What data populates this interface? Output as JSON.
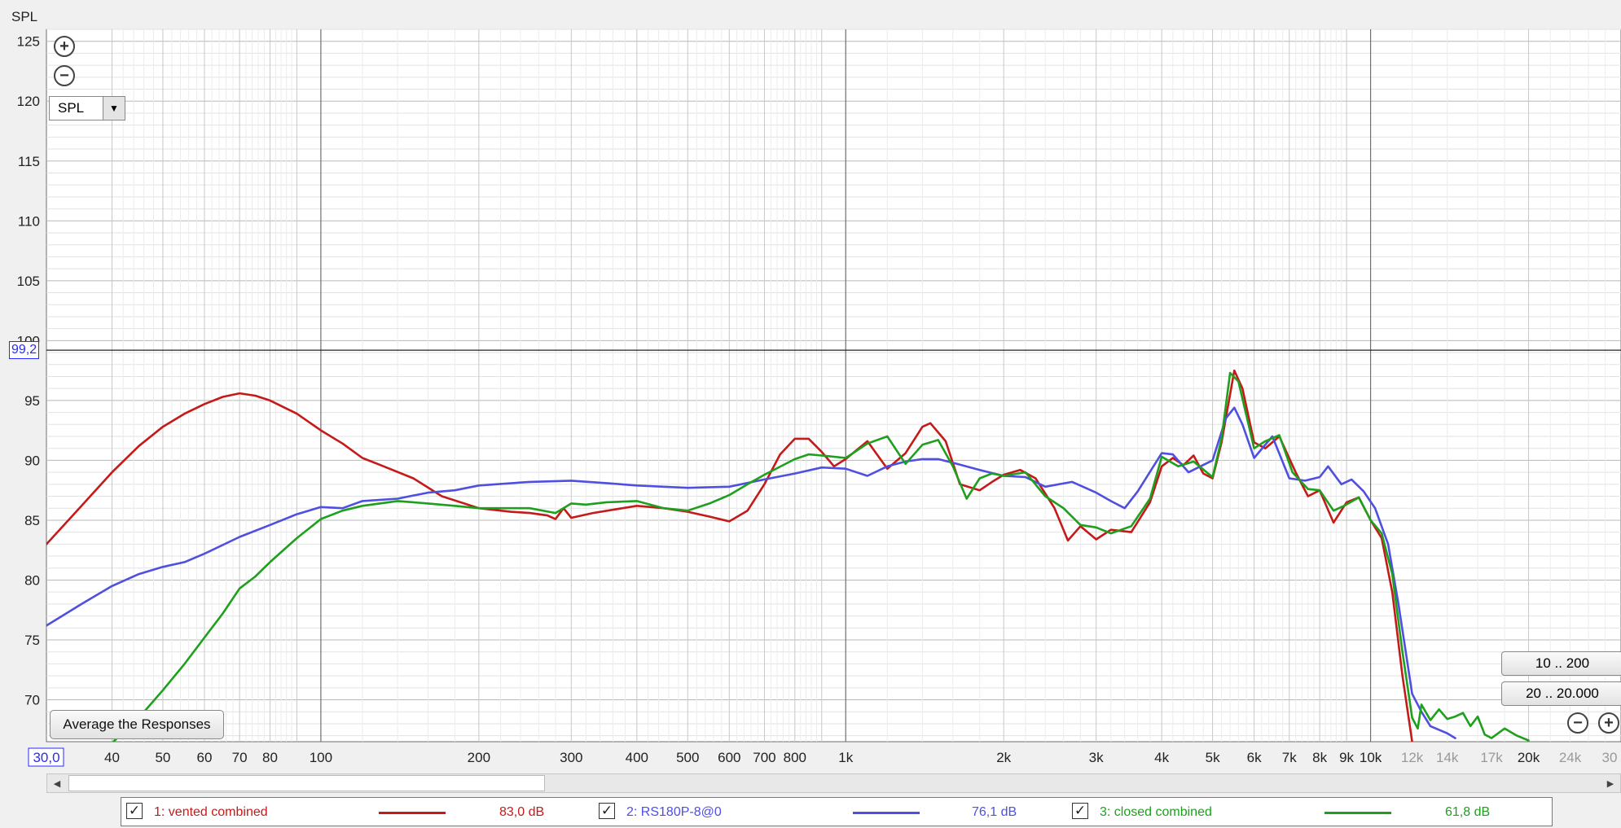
{
  "chart_data": {
    "type": "line",
    "title": "",
    "ylabel": "SPL",
    "xlabel": "",
    "x_scale": "log",
    "xlim": [
      30,
      30000
    ],
    "ylim": [
      66.5,
      126
    ],
    "y_ticks": [
      70,
      75,
      80,
      85,
      90,
      95,
      100,
      105,
      110,
      115,
      120,
      125
    ],
    "x_ticks": [
      {
        "v": 30,
        "label": "30,0",
        "highlight": true
      },
      {
        "v": 40,
        "label": "40"
      },
      {
        "v": 50,
        "label": "50"
      },
      {
        "v": 60,
        "label": "60"
      },
      {
        "v": 70,
        "label": "70"
      },
      {
        "v": 80,
        "label": "80"
      },
      {
        "v": 100,
        "label": "100"
      },
      {
        "v": 200,
        "label": "200"
      },
      {
        "v": 300,
        "label": "300"
      },
      {
        "v": 400,
        "label": "400"
      },
      {
        "v": 500,
        "label": "500"
      },
      {
        "v": 600,
        "label": "600"
      },
      {
        "v": 700,
        "label": "700"
      },
      {
        "v": 800,
        "label": "800"
      },
      {
        "v": 1000,
        "label": "1k"
      },
      {
        "v": 2000,
        "label": "2k"
      },
      {
        "v": 3000,
        "label": "3k"
      },
      {
        "v": 4000,
        "label": "4k"
      },
      {
        "v": 5000,
        "label": "5k"
      },
      {
        "v": 6000,
        "label": "6k"
      },
      {
        "v": 7000,
        "label": "7k"
      },
      {
        "v": 8000,
        "label": "8k"
      },
      {
        "v": 9000,
        "label": "9k"
      },
      {
        "v": 10000,
        "label": "10k"
      },
      {
        "v": 12000,
        "label": "12k",
        "faint": true
      },
      {
        "v": 14000,
        "label": "14k",
        "faint": true
      },
      {
        "v": 17000,
        "label": "17k",
        "faint": true
      },
      {
        "v": 20000,
        "label": "20k"
      },
      {
        "v": 24000,
        "label": "24k",
        "faint": true
      },
      {
        "v": 30000,
        "label": "30",
        "faint": true
      }
    ],
    "cursor": {
      "y": 99.2,
      "label": "99,2"
    },
    "grid": true,
    "series": [
      {
        "name": "1: vented combined",
        "color": "#c41a1a",
        "legend_value": "83,0 dB",
        "points": [
          [
            30,
            83.0
          ],
          [
            35,
            86.2
          ],
          [
            40,
            89.0
          ],
          [
            45,
            91.2
          ],
          [
            50,
            92.8
          ],
          [
            55,
            93.9
          ],
          [
            60,
            94.7
          ],
          [
            65,
            95.3
          ],
          [
            70,
            95.6
          ],
          [
            75,
            95.4
          ],
          [
            80,
            95.0
          ],
          [
            90,
            93.9
          ],
          [
            100,
            92.5
          ],
          [
            110,
            91.4
          ],
          [
            120,
            90.2
          ],
          [
            130,
            89.6
          ],
          [
            150,
            88.5
          ],
          [
            170,
            87.0
          ],
          [
            200,
            86.0
          ],
          [
            230,
            85.7
          ],
          [
            250,
            85.6
          ],
          [
            270,
            85.4
          ],
          [
            280,
            85.1
          ],
          [
            290,
            86.0
          ],
          [
            300,
            85.2
          ],
          [
            330,
            85.6
          ],
          [
            400,
            86.2
          ],
          [
            450,
            86.0
          ],
          [
            500,
            85.7
          ],
          [
            550,
            85.3
          ],
          [
            600,
            84.9
          ],
          [
            650,
            85.8
          ],
          [
            700,
            88.0
          ],
          [
            750,
            90.5
          ],
          [
            800,
            91.8
          ],
          [
            850,
            91.8
          ],
          [
            900,
            90.7
          ],
          [
            950,
            89.5
          ],
          [
            1000,
            90.1
          ],
          [
            1100,
            91.6
          ],
          [
            1200,
            89.3
          ],
          [
            1300,
            90.6
          ],
          [
            1400,
            92.8
          ],
          [
            1450,
            93.1
          ],
          [
            1550,
            91.6
          ],
          [
            1650,
            88.0
          ],
          [
            1800,
            87.5
          ],
          [
            1900,
            88.2
          ],
          [
            2000,
            88.8
          ],
          [
            2150,
            89.2
          ],
          [
            2300,
            88.5
          ],
          [
            2500,
            86.0
          ],
          [
            2650,
            83.3
          ],
          [
            2800,
            84.5
          ],
          [
            3000,
            83.4
          ],
          [
            3200,
            84.2
          ],
          [
            3500,
            84.0
          ],
          [
            3800,
            86.5
          ],
          [
            4000,
            89.5
          ],
          [
            4200,
            90.2
          ],
          [
            4400,
            89.6
          ],
          [
            4600,
            90.4
          ],
          [
            4800,
            88.9
          ],
          [
            5000,
            88.5
          ],
          [
            5200,
            91.5
          ],
          [
            5500,
            97.5
          ],
          [
            5700,
            96.0
          ],
          [
            6000,
            91.5
          ],
          [
            6300,
            91.0
          ],
          [
            6700,
            92.0
          ],
          [
            7200,
            89.0
          ],
          [
            7600,
            87.0
          ],
          [
            8000,
            87.5
          ],
          [
            8500,
            84.8
          ],
          [
            9000,
            86.5
          ],
          [
            9500,
            86.9
          ],
          [
            10000,
            85.0
          ],
          [
            10500,
            83.5
          ],
          [
            11000,
            79.0
          ],
          [
            11500,
            72.0
          ],
          [
            12000,
            66.5
          ]
        ]
      },
      {
        "name": "2: RS180P-8@0",
        "color": "#4f4fe0",
        "legend_value": "76,1 dB",
        "points": [
          [
            30,
            76.2
          ],
          [
            35,
            78.0
          ],
          [
            40,
            79.5
          ],
          [
            45,
            80.5
          ],
          [
            50,
            81.1
          ],
          [
            55,
            81.5
          ],
          [
            60,
            82.2
          ],
          [
            70,
            83.6
          ],
          [
            80,
            84.6
          ],
          [
            90,
            85.5
          ],
          [
            100,
            86.1
          ],
          [
            110,
            86.0
          ],
          [
            120,
            86.6
          ],
          [
            140,
            86.8
          ],
          [
            160,
            87.3
          ],
          [
            180,
            87.5
          ],
          [
            200,
            87.9
          ],
          [
            250,
            88.2
          ],
          [
            300,
            88.3
          ],
          [
            350,
            88.1
          ],
          [
            400,
            87.9
          ],
          [
            500,
            87.7
          ],
          [
            600,
            87.8
          ],
          [
            700,
            88.4
          ],
          [
            800,
            88.9
          ],
          [
            900,
            89.4
          ],
          [
            1000,
            89.3
          ],
          [
            1100,
            88.7
          ],
          [
            1200,
            89.5
          ],
          [
            1300,
            89.9
          ],
          [
            1400,
            90.1
          ],
          [
            1500,
            90.1
          ],
          [
            1600,
            89.8
          ],
          [
            1800,
            89.2
          ],
          [
            2000,
            88.7
          ],
          [
            2200,
            88.6
          ],
          [
            2400,
            87.8
          ],
          [
            2700,
            88.2
          ],
          [
            3000,
            87.3
          ],
          [
            3200,
            86.6
          ],
          [
            3400,
            86.0
          ],
          [
            3600,
            87.4
          ],
          [
            4000,
            90.6
          ],
          [
            4200,
            90.5
          ],
          [
            4500,
            89.0
          ],
          [
            5000,
            90.0
          ],
          [
            5300,
            93.5
          ],
          [
            5500,
            94.4
          ],
          [
            5700,
            93.0
          ],
          [
            6000,
            90.2
          ],
          [
            6500,
            92.0
          ],
          [
            7000,
            88.5
          ],
          [
            7500,
            88.3
          ],
          [
            8000,
            88.6
          ],
          [
            8300,
            89.5
          ],
          [
            8800,
            88.0
          ],
          [
            9200,
            88.4
          ],
          [
            9700,
            87.4
          ],
          [
            10200,
            86.0
          ],
          [
            10800,
            83.0
          ],
          [
            11300,
            78.0
          ],
          [
            12000,
            70.5
          ],
          [
            12500,
            69.0
          ],
          [
            13000,
            67.8
          ],
          [
            14000,
            67.2
          ],
          [
            14500,
            66.8
          ]
        ]
      },
      {
        "name": "3: closed combined",
        "color": "#1ea01e",
        "legend_value": "61,8 dB",
        "points": [
          [
            40,
            66.4
          ],
          [
            45,
            68.5
          ],
          [
            50,
            70.8
          ],
          [
            55,
            73.0
          ],
          [
            60,
            75.2
          ],
          [
            65,
            77.2
          ],
          [
            70,
            79.3
          ],
          [
            75,
            80.3
          ],
          [
            80,
            81.5
          ],
          [
            90,
            83.5
          ],
          [
            100,
            85.1
          ],
          [
            110,
            85.8
          ],
          [
            120,
            86.2
          ],
          [
            140,
            86.6
          ],
          [
            160,
            86.4
          ],
          [
            180,
            86.2
          ],
          [
            200,
            86.0
          ],
          [
            250,
            86.0
          ],
          [
            280,
            85.6
          ],
          [
            300,
            86.4
          ],
          [
            320,
            86.3
          ],
          [
            350,
            86.5
          ],
          [
            400,
            86.6
          ],
          [
            450,
            86.0
          ],
          [
            500,
            85.8
          ],
          [
            550,
            86.4
          ],
          [
            600,
            87.1
          ],
          [
            650,
            88.0
          ],
          [
            700,
            88.8
          ],
          [
            800,
            90.1
          ],
          [
            850,
            90.5
          ],
          [
            900,
            90.4
          ],
          [
            1000,
            90.2
          ],
          [
            1100,
            91.4
          ],
          [
            1200,
            92.0
          ],
          [
            1300,
            89.7
          ],
          [
            1400,
            91.3
          ],
          [
            1500,
            91.7
          ],
          [
            1600,
            89.5
          ],
          [
            1700,
            86.8
          ],
          [
            1800,
            88.5
          ],
          [
            1900,
            88.9
          ],
          [
            2000,
            88.7
          ],
          [
            2200,
            89.0
          ],
          [
            2400,
            87.0
          ],
          [
            2600,
            86.0
          ],
          [
            2800,
            84.6
          ],
          [
            3000,
            84.4
          ],
          [
            3200,
            83.9
          ],
          [
            3500,
            84.5
          ],
          [
            3800,
            86.8
          ],
          [
            4000,
            90.3
          ],
          [
            4300,
            89.5
          ],
          [
            4600,
            89.9
          ],
          [
            5000,
            88.6
          ],
          [
            5200,
            91.8
          ],
          [
            5400,
            97.3
          ],
          [
            5600,
            96.6
          ],
          [
            6000,
            91.0
          ],
          [
            6300,
            91.6
          ],
          [
            6700,
            92.1
          ],
          [
            7100,
            89.0
          ],
          [
            7600,
            87.6
          ],
          [
            8000,
            87.5
          ],
          [
            8500,
            85.8
          ],
          [
            8900,
            86.2
          ],
          [
            9500,
            86.9
          ],
          [
            10000,
            85.0
          ],
          [
            10500,
            83.9
          ],
          [
            11000,
            80.5
          ],
          [
            11500,
            74.0
          ],
          [
            12000,
            68.5
          ],
          [
            12300,
            67.6
          ],
          [
            12500,
            69.6
          ],
          [
            13000,
            68.3
          ],
          [
            13500,
            69.2
          ],
          [
            14000,
            68.4
          ],
          [
            14500,
            68.6
          ],
          [
            15000,
            68.9
          ],
          [
            15500,
            67.8
          ],
          [
            16000,
            68.6
          ],
          [
            16500,
            67.1
          ],
          [
            17000,
            66.8
          ],
          [
            18000,
            67.6
          ],
          [
            19000,
            67.0
          ],
          [
            20000,
            66.6
          ]
        ]
      }
    ]
  },
  "ui": {
    "y_axis_title": "SPL",
    "zoom_in_symbol": "+",
    "zoom_out_symbol": "−",
    "measurement_select": "SPL",
    "select_arrow": "▼",
    "average_button": "Average the Responses",
    "range_buttons": [
      "10 .. 200",
      "20 .. 20.000"
    ],
    "scroll_left_arrow": "◀",
    "scroll_right_arrow": "▶",
    "legend": [
      {
        "check": "✓",
        "name": "1: vented combined",
        "value": "83,0 dB",
        "color": "#c41a1a"
      },
      {
        "check": "✓",
        "name": "2: RS180P-8@0",
        "value": "76,1 dB",
        "color": "#4f4fe0"
      },
      {
        "check": "✓",
        "name": "3: closed combined",
        "value": "61,8 dB",
        "color": "#1ea01e"
      }
    ]
  }
}
